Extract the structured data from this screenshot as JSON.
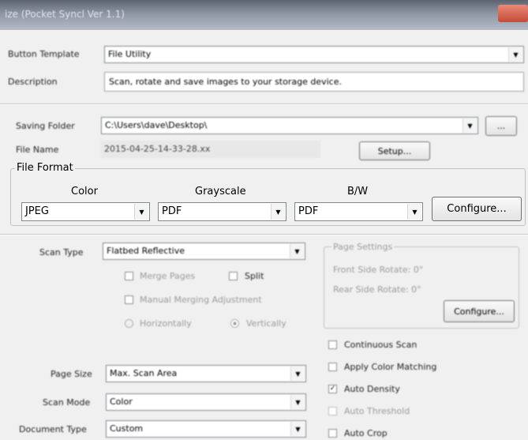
{
  "window": {
    "title": "ize (Pocket Syncl Ver 1.1)"
  },
  "template": {
    "button_label": "Button Template",
    "button_value": "File Utility",
    "description_label": "Description",
    "description_value": "Scan, rotate and save images to your storage device."
  },
  "saving": {
    "folder_label": "Saving Folder",
    "folder_value": "C:\\Users\\dave\\Desktop\\",
    "browse_label": "...",
    "filename_label": "File Name",
    "filename_value": "2015-04-25-14-33-28.xx",
    "setup_label": "Setup..."
  },
  "file_format": {
    "legend": "File Format",
    "color_label": "Color",
    "grayscale_label": "Grayscale",
    "bw_label": "B/W",
    "color_value": "JPEG",
    "grayscale_value": "PDF",
    "bw_value": "PDF",
    "configure_label": "Configure..."
  },
  "scan": {
    "type_label": "Scan Type",
    "type_value": "Flatbed Reflective",
    "merge_pages": "Merge Pages",
    "split": "Split",
    "manual_merge": "Manual Merging Adjustment",
    "horizontally": "Horizontally",
    "vertically": "Vertically"
  },
  "page_settings": {
    "legend": "Page Settings",
    "front_rotate": "Front Side Rotate: 0°",
    "rear_rotate": "Rear Side Rotate: 0°",
    "configure_label": "Configure..."
  },
  "options": {
    "continuous": "Continuous Scan",
    "color_matching": "Apply Color Matching",
    "auto_density": "Auto Density",
    "auto_threshold": "Auto Threshold",
    "auto_crop": "Auto Crop",
    "check_mark": "✓"
  },
  "bottom": {
    "page_size_label": "Page Size",
    "page_size_value": "Max. Scan Area",
    "scan_mode_label": "Scan Mode",
    "scan_mode_value": "Color",
    "doc_type_label": "Document Type",
    "doc_type_value": "Custom"
  },
  "icons": {
    "dropdown": "▼"
  }
}
